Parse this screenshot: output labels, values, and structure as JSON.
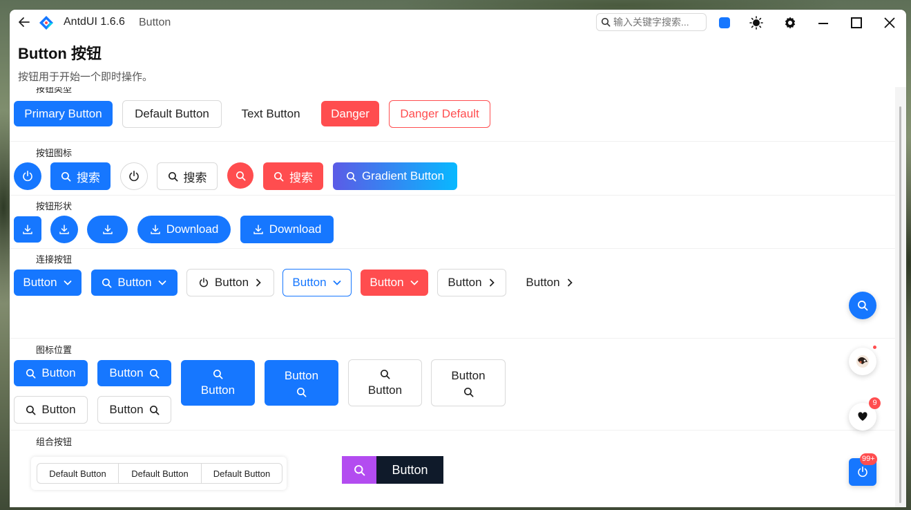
{
  "titlebar": {
    "app_name": "AntdUI 1.6.6",
    "page_name": "Button",
    "search_placeholder": "输入关键字搜索...",
    "theme_color": "#1677ff"
  },
  "header": {
    "title": "Button 按钮",
    "description": "按钮用于开始一个即时操作。"
  },
  "sections": {
    "types": "按钮类型",
    "icons": "按钮图标",
    "shapes": "按钮形状",
    "joined": "连接按钮",
    "icon_position": "图标位置",
    "group": "组合按钮"
  },
  "types_row": {
    "primary": "Primary Button",
    "default": "Default Button",
    "text": "Text Button",
    "danger": "Danger",
    "danger_default": "Danger Default"
  },
  "icons_row": {
    "search_label": "搜索",
    "gradient": "Gradient Button"
  },
  "shapes_row": {
    "download": "Download"
  },
  "joined_row": {
    "label": "Button"
  },
  "position_row": {
    "label": "Button"
  },
  "group_row": {
    "items": [
      "Default Button",
      "Default Button",
      "Default Button"
    ],
    "combo_label": "Button"
  },
  "floats": {
    "heart_badge": "9",
    "power_badge": "99+"
  },
  "colors": {
    "primary": "#1677ff",
    "danger": "#ff4d4f",
    "combo_icon_bg": "#b34cf0",
    "combo_text_bg": "#0f1a2a"
  }
}
